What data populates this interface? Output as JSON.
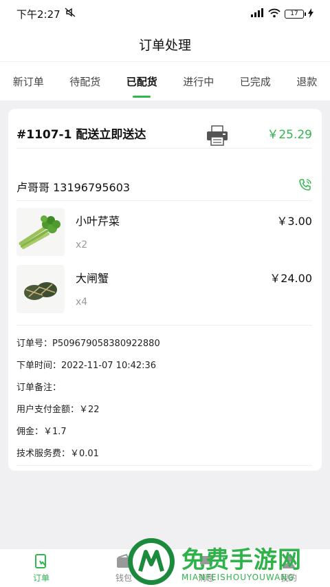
{
  "status_bar": {
    "time": "下午2:27",
    "battery": "17"
  },
  "header": {
    "title": "订单处理"
  },
  "tabs": [
    {
      "label": "新订单"
    },
    {
      "label": "待配货"
    },
    {
      "label": "已配货"
    },
    {
      "label": "进行中"
    },
    {
      "label": "已完成"
    },
    {
      "label": "退款"
    }
  ],
  "active_tab": "已配货",
  "order": {
    "id": "#1107-1 配送立即送达",
    "price": "￥25.29",
    "customer": "卢哥哥 13196795603",
    "items": [
      {
        "name": "小叶芹菜",
        "qty": "x2",
        "price": "￥3.00"
      },
      {
        "name": "大闸蟹",
        "qty": "x4",
        "price": "￥24.00"
      }
    ],
    "info": [
      "订单号：P509679058380922880",
      "下单时间：2022-11-07 10:42:36",
      "订单备注：",
      "用户支付金额：￥22",
      "佣金：￥1.7",
      "技术服务费：￥0.01"
    ]
  },
  "bottom_nav": [
    {
      "label": "订单"
    },
    {
      "label": "钱包"
    },
    {
      "label": "消息"
    },
    {
      "label": "我的"
    }
  ],
  "watermark": {
    "title": "免费手游网",
    "subtitle": "MIANFEISHOUYOUWANG"
  },
  "colors": {
    "accent": "#2db84d",
    "background": "#f0f0f2"
  }
}
